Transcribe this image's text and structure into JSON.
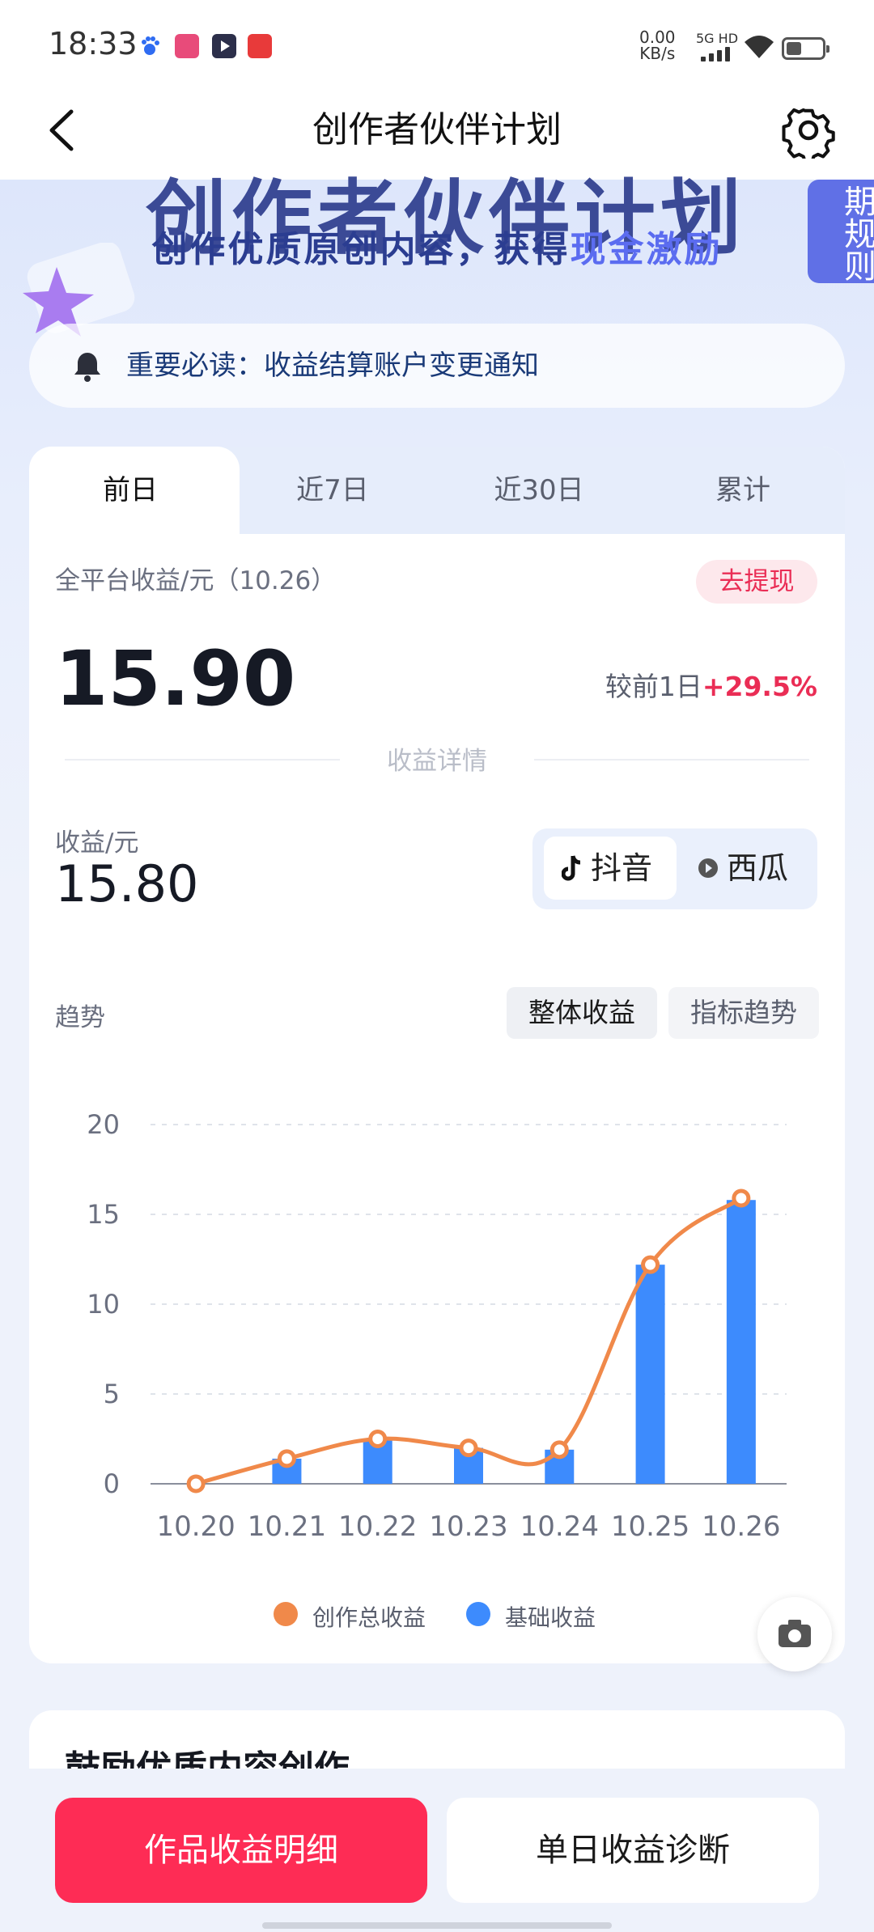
{
  "status_bar": {
    "time": "18:33",
    "net_speed_value": "0.00",
    "net_speed_unit": "KB/s",
    "signal": "5G HD",
    "app_icons": [
      "baidu-icon",
      "bilibili-icon",
      "video-player-icon",
      "toutiao-icon"
    ],
    "icon_colors": [
      "#2f6cf2",
      "#e84b7a",
      "#2c2f4a",
      "#e83a3a"
    ]
  },
  "nav": {
    "title": "创作者伙伴计划"
  },
  "hero": {
    "banner_title": "创作者伙伴计划",
    "subtitle_prefix": "创作优质原创内容，获得",
    "subtitle_highlight": "现金激励",
    "rules_tab": "期规则"
  },
  "notice": {
    "text": "重要必读：收益结算账户变更通知"
  },
  "tabs": [
    {
      "label": "前日"
    },
    {
      "label": "近7日"
    },
    {
      "label": "近30日"
    },
    {
      "label": "累计"
    }
  ],
  "earnings": {
    "label": "全平台收益/元（10.26）",
    "withdraw": "去提现",
    "total": "15.90",
    "compare_prefix": "较前1日",
    "compare_value": "+29.5%",
    "detail_divider": "收益详情",
    "sub_label": "收益/元",
    "sub_value": "15.80"
  },
  "platform_toggle": {
    "douyin": "抖音",
    "xigua": "西瓜"
  },
  "trend": {
    "label": "趋势",
    "overall_btn": "整体收益",
    "indicator_btn": "指标趋势"
  },
  "chart_data": {
    "type": "bar",
    "categories": [
      "10.20",
      "10.21",
      "10.22",
      "10.23",
      "10.24",
      "10.25",
      "10.26"
    ],
    "series": [
      {
        "name": "创作总收益",
        "type": "line",
        "values": [
          0,
          1.4,
          2.5,
          2.0,
          1.9,
          12.2,
          15.9
        ],
        "color": "#f0894a"
      },
      {
        "name": "基础收益",
        "type": "bar",
        "values": [
          0,
          1.4,
          2.5,
          2.0,
          1.9,
          12.2,
          15.8
        ],
        "color": "#3d8bfd"
      }
    ],
    "yticks": [
      0,
      5,
      10,
      15,
      20
    ],
    "ylim": [
      0,
      20
    ],
    "grid": true,
    "legend": "bottom"
  },
  "second_card": {
    "title": "鼓励优质内容创作"
  },
  "bottom_buttons": {
    "primary": "作品收益明细",
    "secondary": "单日收益诊断"
  }
}
